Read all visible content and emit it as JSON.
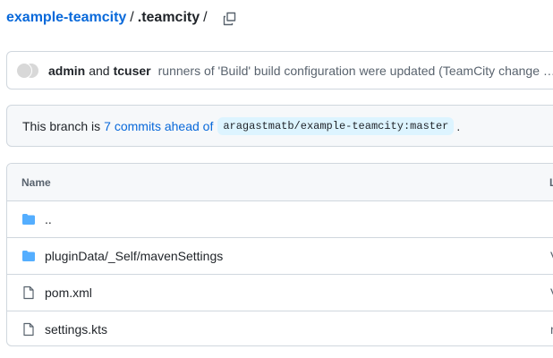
{
  "breadcrumb": {
    "repo": "example-teamcity",
    "separator": "/",
    "folder": ".teamcity",
    "trailing": "/"
  },
  "commit": {
    "author1": "admin",
    "and": "and",
    "author2": "tcuser",
    "message": "runners of 'Build' build configuration were updated (TeamCity change …"
  },
  "branch": {
    "prefix": "This branch is",
    "link": "7 commits ahead of",
    "ref": "aragastmatb/example-teamcity:master",
    "suffix": "."
  },
  "table": {
    "header_name": "Name",
    "header_last": "L",
    "rows": [
      {
        "name": "..",
        "type": "folder",
        "last": ""
      },
      {
        "name": "pluginData/_Self/mavenSettings",
        "type": "folder",
        "last": "V"
      },
      {
        "name": "pom.xml",
        "type": "file",
        "last": "V"
      },
      {
        "name": "settings.kts",
        "type": "file",
        "last": "r"
      }
    ]
  },
  "colors": {
    "link": "#0969da",
    "folder": "#54aeff",
    "border": "#d0d7de"
  }
}
